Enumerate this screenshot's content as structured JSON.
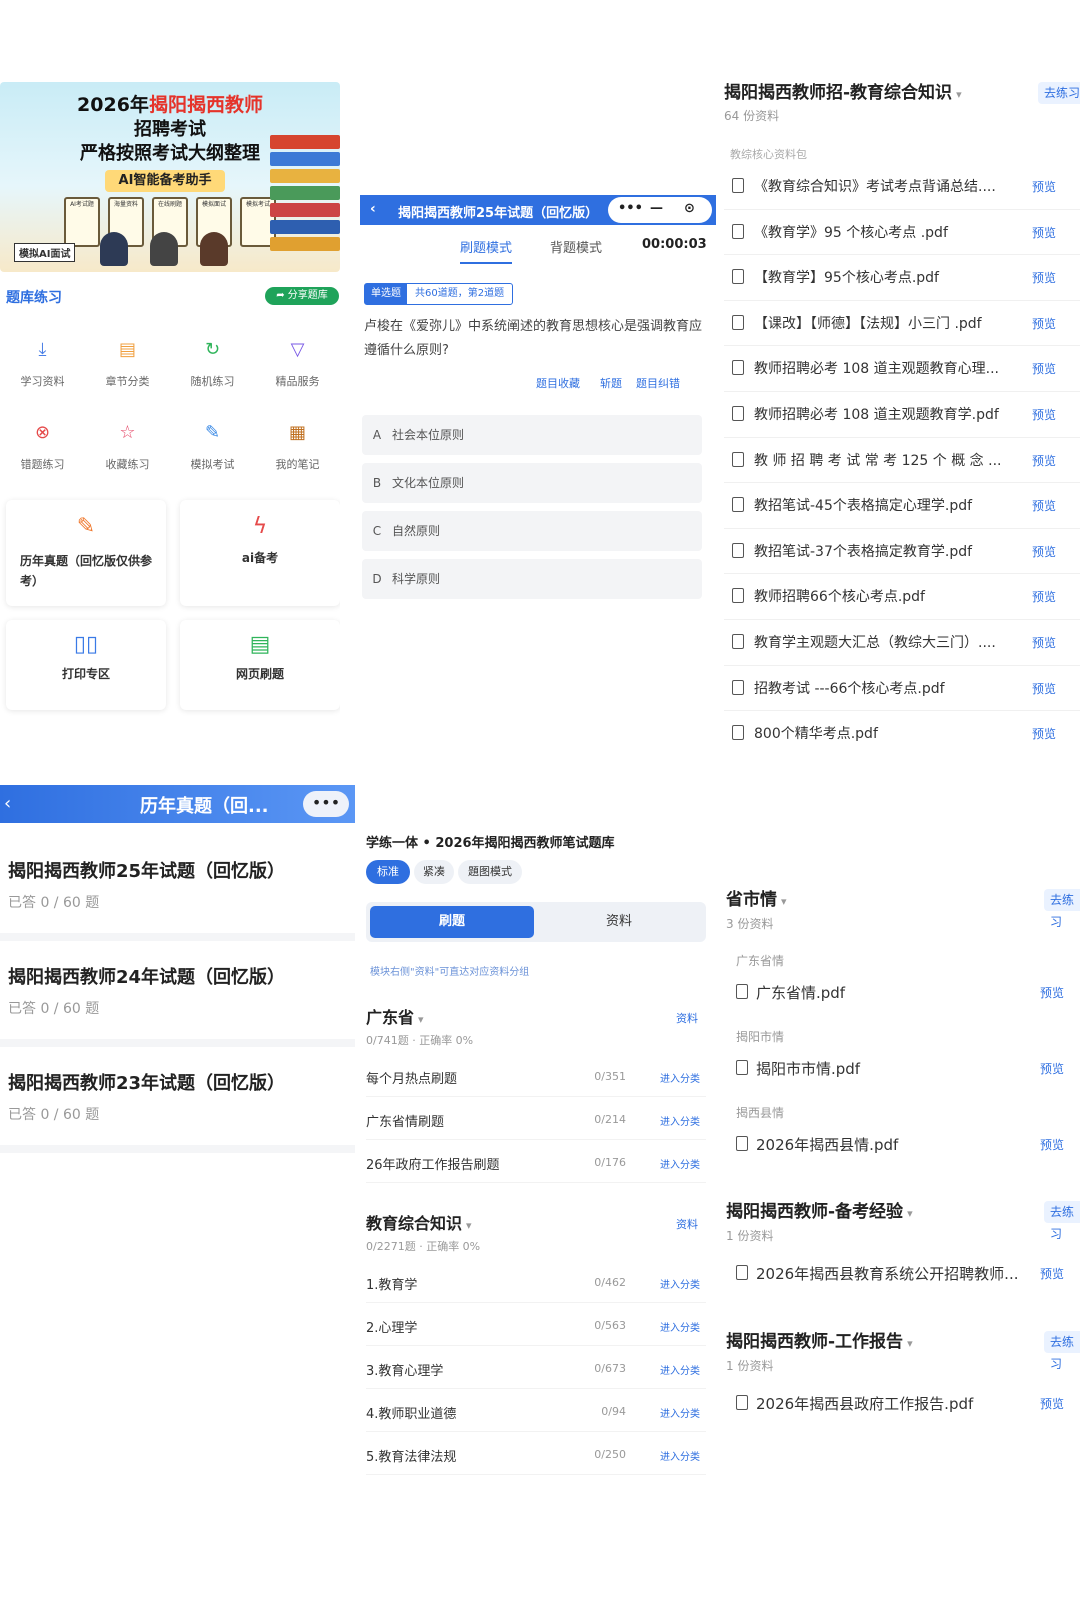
{
  "banner": {
    "year": "2026年",
    "highlight": "揭阳揭西教师",
    "line2": "招聘考试",
    "line3": "严格按照考试大纲整理",
    "tag": "AI智能备考助手",
    "ai_test": "模拟AI面试",
    "minis": [
      "AI考试题",
      "海量资料",
      "在线刷题",
      "模拟面试",
      "模拟考试"
    ]
  },
  "panel1": {
    "section_title": "题库练习",
    "share": "分享题库",
    "icons": [
      {
        "label": "学习资料",
        "icon": "download-icon",
        "color": "#4a7fe6"
      },
      {
        "label": "章节分类",
        "icon": "document-icon",
        "color": "#f0a040"
      },
      {
        "label": "随机练习",
        "icon": "refresh-icon",
        "color": "#2fb45a"
      },
      {
        "label": "精品服务",
        "icon": "filter-icon",
        "color": "#7a5ae6"
      },
      {
        "label": "错题练习",
        "icon": "error-icon",
        "color": "#e54a4a"
      },
      {
        "label": "收藏练习",
        "icon": "star-icon",
        "color": "#e54a6a"
      },
      {
        "label": "模拟考试",
        "icon": "exam-icon",
        "color": "#3a8ae6"
      },
      {
        "label": "我的笔记",
        "icon": "notes-icon",
        "color": "#c07020"
      }
    ],
    "cards": [
      {
        "label": "历年真题（回忆版仅供参考）",
        "icon": "edit-icon"
      },
      {
        "label": "ai备考",
        "icon": "ai-icon"
      },
      {
        "label": "打印专区",
        "icon": "book-icon"
      },
      {
        "label": "网页刷题",
        "icon": "page-icon"
      }
    ]
  },
  "panel2": {
    "title": "揭阳揭西教师25年试题（回忆版）",
    "modes": [
      "刷题模式",
      "背题模式"
    ],
    "timer": "00:00:03",
    "qtype": "单选题",
    "qprogress": "共60道题，第2道题",
    "question": "卢梭在《爱弥儿》中系统阐述的教育思想核心是强调教育应遵循什么原则?",
    "actions": [
      "题目收藏",
      "斩题",
      "题目纠错"
    ],
    "options": [
      {
        "key": "A",
        "text": "社会本位原则"
      },
      {
        "key": "B",
        "text": "文化本位原则"
      },
      {
        "key": "C",
        "text": "自然原则"
      },
      {
        "key": "D",
        "text": "科学原则"
      }
    ]
  },
  "panel3": {
    "title": "揭阳揭西教师招-教育综合知识",
    "count": "64 份资料",
    "go": "去练习",
    "package": "教综核心资料包",
    "preview": "预览",
    "files": [
      "《教育综合知识》考试考点背诵总结....",
      "《教育学》95 个核心考点 .pdf",
      "【教育学】95个核心考点.pdf",
      "【课改】【师德】【法规】小三门 .pdf",
      "教师招聘必考 108 道主观题教育心理...",
      "教师招聘必考 108 道主观题教育学.pdf",
      "教 师 招 聘 考 试 常 考 125 个 概 念 ...",
      "教招笔试-45个表格搞定心理学.pdf",
      "教招笔试-37个表格搞定教育学.pdf",
      "教师招聘66个核心考点.pdf",
      "教育学主观题大汇总（教综大三门）....",
      "招教考试 ---66个核心考点.pdf",
      "800个精华考点.pdf"
    ]
  },
  "panel4": {
    "title": "历年真题（回...",
    "exams": [
      {
        "title": "揭阳揭西教师25年试题（回忆版）",
        "status": "已答 0 / 60 题"
      },
      {
        "title": "揭阳揭西教师24年试题（回忆版）",
        "status": "已答 0 / 60 题"
      },
      {
        "title": "揭阳揭西教师23年试题（回忆版）",
        "status": "已答 0 / 60 题"
      }
    ]
  },
  "panel5": {
    "header": "学练一体 • 2026年揭阳揭西教师笔试题库",
    "pills": [
      "标准",
      "紧凑",
      "題图模式"
    ],
    "seg": [
      "刷题",
      "资料"
    ],
    "hint": "模块右侧\"资料\"可直达对应资料分组",
    "groups": [
      {
        "title": "广东省",
        "stats": "0/741题 · 正确率 0%",
        "badge": "资料",
        "rows": [
          {
            "name": "每个月热点刷题",
            "count": "0/351",
            "enter": "进入分类"
          },
          {
            "name": "广东省情刷题",
            "count": "0/214",
            "enter": "进入分类"
          },
          {
            "name": "26年政府工作报告刷题",
            "count": "0/176",
            "enter": "进入分类"
          }
        ]
      },
      {
        "title": "教育综合知识",
        "stats": "0/2271题 · 正确率 0%",
        "badge": "资料",
        "rows": [
          {
            "name": "1.教育学",
            "count": "0/462",
            "enter": "进入分类"
          },
          {
            "name": "2.心理学",
            "count": "0/563",
            "enter": "进入分类"
          },
          {
            "name": "3.教育心理学",
            "count": "0/673",
            "enter": "进入分类"
          },
          {
            "name": "4.教师职业道德",
            "count": "0/94",
            "enter": "进入分类"
          },
          {
            "name": "5.教育法律法规",
            "count": "0/250",
            "enter": "进入分类"
          }
        ]
      }
    ]
  },
  "panel6": {
    "preview": "预览",
    "go": "去练习",
    "sections": [
      {
        "title": "省市情",
        "count": "3 份资料",
        "subgroups": [
          {
            "label": "广东省情",
            "file": "广东省情.pdf"
          },
          {
            "label": "揭阳市情",
            "file": "揭阳市市情.pdf"
          },
          {
            "label": "揭西县情",
            "file": "2026年揭西县情.pdf"
          }
        ]
      },
      {
        "title": "揭阳揭西教师-备考经验",
        "count": "1 份资料",
        "file": "2026年揭西县教育系统公开招聘教师..."
      },
      {
        "title": "揭阳揭西教师-工作报告",
        "count": "1 份资料",
        "file": "2026年揭西县政府工作报告.pdf"
      }
    ]
  }
}
